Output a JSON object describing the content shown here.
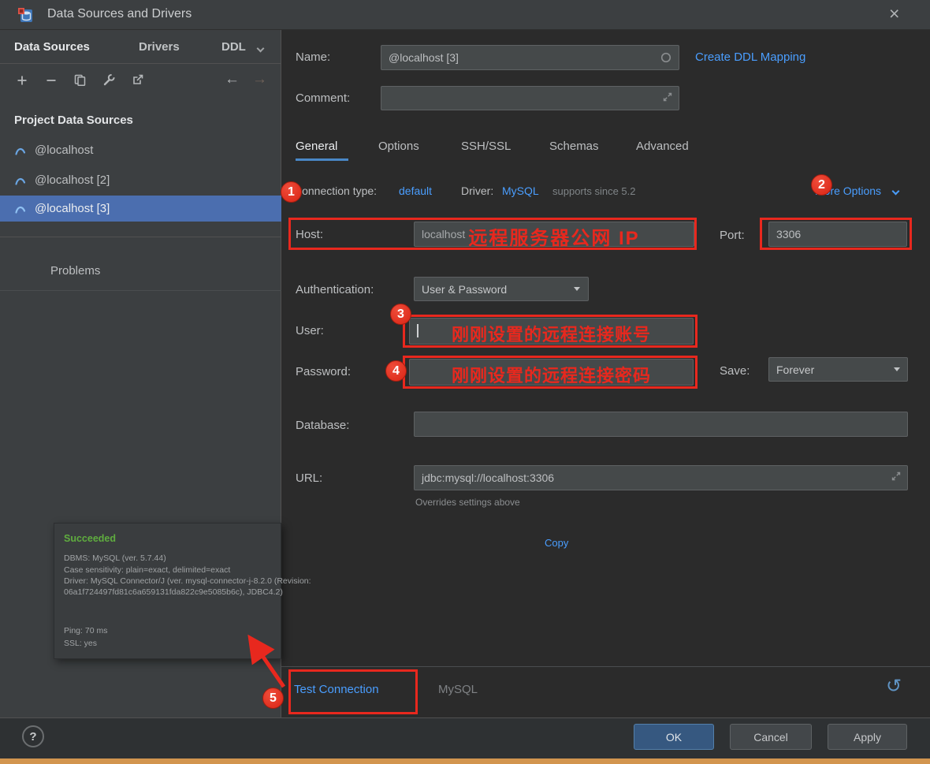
{
  "colors": {
    "annotation_red": "#e8281e",
    "link_blue": "#4a9eff",
    "selection_blue": "#4b6eaf",
    "success_green": "#5fad3f",
    "ok_button_blue": "#365880"
  },
  "titlebar": {
    "title": "Data Sources and Drivers",
    "close": "×"
  },
  "sidebar": {
    "tabs": [
      {
        "label": "Data Sources"
      },
      {
        "label": "Drivers"
      },
      {
        "label": "DDL"
      }
    ],
    "section_title": "Project Data Sources",
    "items": [
      {
        "label": "@localhost"
      },
      {
        "label": "@localhost [2]"
      },
      {
        "label": "@localhost [3]"
      }
    ],
    "problems_label": "Problems"
  },
  "header": {
    "name_label": "Name:",
    "name_value": "@localhost [3]",
    "create_ddl_link": "Create DDL Mapping",
    "comment_label": "Comment:",
    "comment_value": ""
  },
  "tabs": [
    {
      "label": "General"
    },
    {
      "label": "Options"
    },
    {
      "label": "SSH/SSL"
    },
    {
      "label": "Schemas"
    },
    {
      "label": "Advanced"
    }
  ],
  "meta": {
    "connection_type_label": "Connection type:",
    "connection_type_value": "default",
    "driver_label": "Driver:",
    "driver_value": "MySQL",
    "driver_note": "supports since 5.2",
    "more_options_label": "More Options"
  },
  "form": {
    "host_label": "Host:",
    "host_value": "localhost",
    "port_label": "Port:",
    "port_value": "3306",
    "auth_label": "Authentication:",
    "auth_value": "User & Password",
    "user_label": "User:",
    "user_value": "",
    "password_label": "Password:",
    "password_value": "",
    "save_label": "Save:",
    "save_value": "Forever",
    "database_label": "Database:",
    "database_value": "",
    "url_label": "URL:",
    "url_value": "jdbc:mysql://localhost:3306",
    "url_note": "Overrides settings above",
    "copy_link": "Copy"
  },
  "test_result": {
    "status": "Succeeded",
    "dbms": "DBMS: MySQL (ver. 5.7.44)",
    "case_sensitivity": "Case sensitivity: plain=exact, delimited=exact",
    "driver_line1": "Driver: MySQL Connector/J (ver. mysql-connector-j-8.2.0 (Revision:",
    "driver_line2": "06a1f724497fd81c6a659131fda822c9e5085b6c), JDBC4.2)",
    "ping": "Ping: 70 ms",
    "ssl": "SSL: yes"
  },
  "bottom_bar": {
    "test_connection_label": "Test Connection",
    "driver_name": "MySQL",
    "undo": "↺"
  },
  "footer": {
    "help": "?",
    "ok": "OK",
    "cancel": "Cancel",
    "apply": "Apply"
  },
  "annotations": {
    "badge_1": "1",
    "badge_2": "2",
    "badge_3": "3",
    "badge_4": "4",
    "badge_5": "5",
    "host_note": "远程服务器公网 IP",
    "user_note": "刚刚设置的远程连接账号",
    "password_note": "刚刚设置的远程连接密码"
  }
}
